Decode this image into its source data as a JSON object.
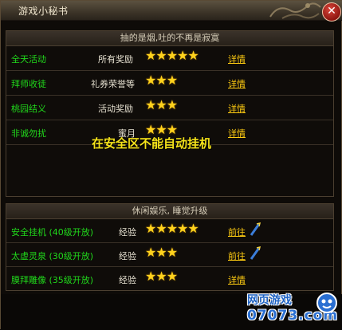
{
  "window": {
    "title": "游戏小秘书",
    "close_icon": "close-icon"
  },
  "panel1": {
    "header": "抽的是烟,吐的不再是寂寞",
    "rows": [
      {
        "name": "全天活动",
        "reward": "所有奖励",
        "stars": "★★★★★",
        "link": "详情"
      },
      {
        "name": "拜师收徒",
        "reward": "礼券荣誉等",
        "stars": "★★★",
        "link": "详情"
      },
      {
        "name": "桃园结义",
        "reward": "活动奖励",
        "stars": "★★★",
        "link": "详情"
      },
      {
        "name": "非诚勿扰",
        "reward": "蜜月",
        "stars": "★★★",
        "link": "详情"
      }
    ],
    "notice": "在安全区不能自动挂机"
  },
  "panel2": {
    "header": "休闲娱乐, 睡觉升级",
    "rows": [
      {
        "name": "安全挂机 (40级开放)",
        "reward": "经验",
        "stars": "★★★★★",
        "link": "前往",
        "has_go_icon": true
      },
      {
        "name": "太虚灵泉 (30级开放)",
        "reward": "经验",
        "stars": "★★★",
        "link": "前往",
        "has_go_icon": true
      },
      {
        "name": "膜拜雕像 (35级开放)",
        "reward": "经验",
        "stars": "★★★",
        "link": "详情",
        "has_go_icon": false
      }
    ]
  },
  "watermark": {
    "line1": "网页游戏",
    "line2": "07073.com"
  },
  "colors": {
    "name_green": "#20d81b",
    "link_yellow": "#ffcc11",
    "star_gold": "#ffd21d",
    "notice_yellow": "#f5e31a"
  }
}
